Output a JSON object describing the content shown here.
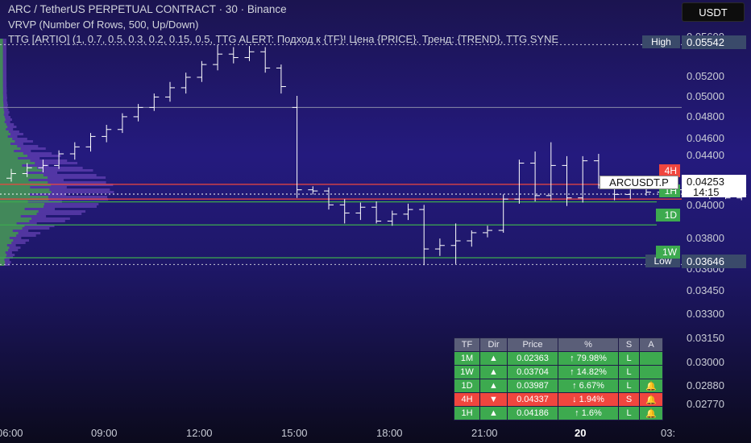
{
  "header": {
    "line1": "ARC / TetherUS PERPETUAL CONTRACT · 30 · Binance",
    "line2": "VRVP (Number Of Rows, 500, Up/Down)",
    "line3": "TTG [ARTIO] (1, 0.7, 0.5, 0.3, 0.2, 0.15, 0.5, TTG ALERT: Подход к {TF}! Цена {PRICE}. Тренд: {TREND}, TTG SYNE"
  },
  "currency_button": "USDT",
  "price_axis": [
    "0.05600",
    "0.05200",
    "0.05000",
    "0.04800",
    "0.04600",
    "0.04400",
    "0.04000",
    "0.03800",
    "0.03600",
    "0.03450",
    "0.03300",
    "0.03150",
    "0.03000",
    "0.02880",
    "0.02770"
  ],
  "time_axis": [
    "06:00",
    "09:00",
    "12:00",
    "15:00",
    "18:00",
    "21:00",
    "20",
    "03:"
  ],
  "markers": {
    "high_label": "High",
    "high_value": "0.05542",
    "low_label": "Low",
    "low_value": "0.03646",
    "symbol_label": "ARCUSDT.P",
    "last_price": "0.04253",
    "countdown": "14:15",
    "level_4h": "4H",
    "level_1h": "1H",
    "level_1d": "1D",
    "level_1w": "1W"
  },
  "table": {
    "headers": [
      "TF",
      "Dir",
      "Price",
      "%",
      "S",
      "A"
    ],
    "rows": [
      {
        "tf": "1M",
        "dir": "▲",
        "price": "0.02363",
        "pct": "↑ 79.98%",
        "s": "L",
        "a": "",
        "color": "green"
      },
      {
        "tf": "1W",
        "dir": "▲",
        "price": "0.03704",
        "pct": "↑ 14.82%",
        "s": "L",
        "a": "",
        "color": "green"
      },
      {
        "tf": "1D",
        "dir": "▲",
        "price": "0.03987",
        "pct": "↑ 6.67%",
        "s": "L",
        "a": "🔔",
        "color": "green"
      },
      {
        "tf": "4H",
        "dir": "▼",
        "price": "0.04337",
        "pct": "↓ 1.94%",
        "s": "S",
        "a": "🔔",
        "color": "red"
      },
      {
        "tf": "1H",
        "dir": "▲",
        "price": "0.04186",
        "pct": "↑ 1.6%",
        "s": "L",
        "a": "🔔",
        "color": "green"
      }
    ]
  },
  "chart_data": {
    "type": "candlestick",
    "candles": [
      [
        0.0439,
        0.0447,
        0.0436,
        0.0443
      ],
      [
        0.0443,
        0.0452,
        0.044,
        0.0448
      ],
      [
        0.0448,
        0.0455,
        0.0444,
        0.045
      ],
      [
        0.045,
        0.0463,
        0.0447,
        0.046
      ],
      [
        0.046,
        0.047,
        0.0455,
        0.0466
      ],
      [
        0.0466,
        0.0478,
        0.0462,
        0.0475
      ],
      [
        0.0475,
        0.0485,
        0.047,
        0.0481
      ],
      [
        0.0481,
        0.0495,
        0.0478,
        0.0492
      ],
      [
        0.0492,
        0.0503,
        0.0488,
        0.05
      ],
      [
        0.05,
        0.0512,
        0.0497,
        0.0509
      ],
      [
        0.0509,
        0.0522,
        0.0505,
        0.0517
      ],
      [
        0.0517,
        0.053,
        0.0512,
        0.0526
      ],
      [
        0.0526,
        0.054,
        0.0522,
        0.0537
      ],
      [
        0.0537,
        0.0554,
        0.0532,
        0.0546
      ],
      [
        0.0546,
        0.0552,
        0.0538,
        0.0543
      ],
      [
        0.0543,
        0.0553,
        0.054,
        0.0548
      ],
      [
        0.0548,
        0.0552,
        0.053,
        0.0534
      ],
      [
        0.0534,
        0.0537,
        0.0512,
        0.0518
      ],
      [
        0.05,
        0.051,
        0.0422,
        0.0429
      ],
      [
        0.0429,
        0.0432,
        0.0425,
        0.0428
      ],
      [
        0.0428,
        0.0431,
        0.0412,
        0.0416
      ],
      [
        0.0416,
        0.0421,
        0.04,
        0.0409
      ],
      [
        0.0409,
        0.0418,
        0.0403,
        0.0414
      ],
      [
        0.0414,
        0.0419,
        0.04,
        0.0402
      ],
      [
        0.0402,
        0.0411,
        0.0398,
        0.0408
      ],
      [
        0.0408,
        0.0417,
        0.0403,
        0.0412
      ],
      [
        0.0412,
        0.0416,
        0.0364,
        0.0378
      ],
      [
        0.0378,
        0.0387,
        0.0372,
        0.0381
      ],
      [
        0.0381,
        0.04,
        0.0365,
        0.0385
      ],
      [
        0.0385,
        0.0394,
        0.038,
        0.0392
      ],
      [
        0.0392,
        0.0398,
        0.0388,
        0.0394
      ],
      [
        0.0394,
        0.0425,
        0.0392,
        0.0421
      ],
      [
        0.0421,
        0.0455,
        0.0417,
        0.0452
      ],
      [
        0.0452,
        0.0462,
        0.0419,
        0.0424
      ],
      [
        0.0424,
        0.047,
        0.042,
        0.045
      ],
      [
        0.045,
        0.0458,
        0.0415,
        0.0422
      ],
      [
        0.0422,
        0.0458,
        0.0418,
        0.0454
      ],
      [
        0.0454,
        0.046,
        0.043,
        0.0433
      ],
      [
        0.0433,
        0.044,
        0.042,
        0.0425
      ],
      [
        0.0425,
        0.0435,
        0.0421,
        0.0431
      ],
      [
        0.0431,
        0.0437,
        0.0424,
        0.0427
      ],
      [
        0.0427,
        0.0441,
        0.0425,
        0.0436
      ],
      [
        0.0436,
        0.0437,
        0.0426,
        0.0429
      ],
      [
        0.0429,
        0.0432,
        0.0423,
        0.0425
      ],
      [
        0.0425,
        0.0428,
        0.0421,
        0.0426
      ],
      [
        0.0426,
        0.043,
        0.0421,
        0.0422
      ],
      [
        0.0422,
        0.0427,
        0.042,
        0.0425
      ],
      [
        0.0425,
        0.043,
        0.0423,
        0.0427
      ],
      [
        0.0427,
        0.0433,
        0.0424,
        0.043
      ],
      [
        0.043,
        0.0437,
        0.0426,
        0.0428
      ],
      [
        0.0428,
        0.0432,
        0.042,
        0.0423
      ],
      [
        0.0423,
        0.0427,
        0.042,
        0.0421
      ],
      [
        0.0421,
        0.0424,
        0.0419,
        0.0422
      ],
      [
        0.0422,
        0.0428,
        0.042,
        0.0426
      ],
      [
        0.0426,
        0.0433,
        0.0423,
        0.0429
      ],
      [
        0.0429,
        0.0431,
        0.0424,
        0.0425
      ]
    ],
    "levels": [
      {
        "name": "4H",
        "value": 0.04337,
        "color": "#f0463e"
      },
      {
        "name": "1H",
        "value": 0.04186,
        "color": "#3daa4f"
      },
      {
        "name": "1D",
        "value": 0.03987,
        "color": "#3daa4f"
      },
      {
        "name": "1W",
        "value": 0.03704,
        "color": "#3daa4f"
      }
    ],
    "red_line": 0.0421,
    "grey_line": 0.05,
    "high": 0.05542,
    "low": 0.03646,
    "last": 0.04253,
    "colors": {
      "candle": "#ffffff",
      "green": "#3daa4f",
      "red": "#f0463e",
      "profile_violet": "#7a4fc9",
      "profile_green": "#3f9e48"
    }
  }
}
